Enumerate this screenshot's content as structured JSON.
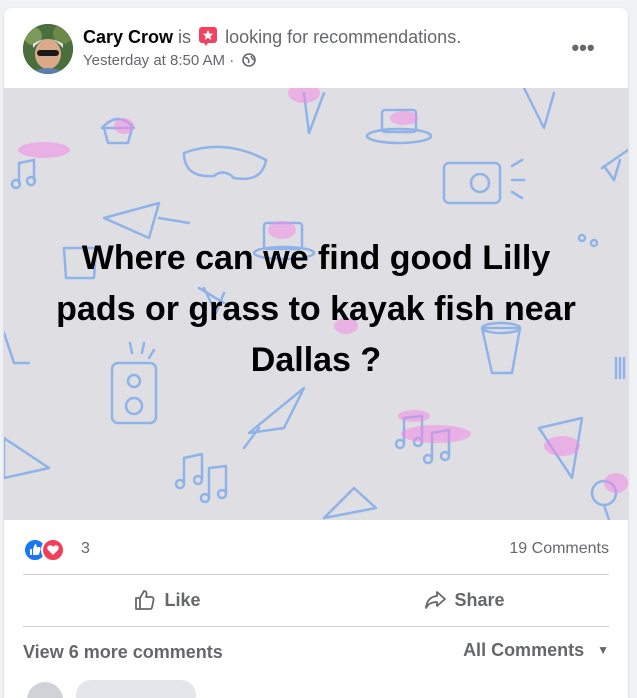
{
  "post": {
    "author": "Cary Crow",
    "is_text": "is",
    "activity": "looking for recommendations.",
    "timestamp": "Yesterday at 8:50 AM ·",
    "text": "Where can we find good Lilly pads or grass to kayak fish near Dallas ?"
  },
  "icons": {
    "activity": "recommendation-star-icon",
    "privacy": "globe-icon",
    "more": "more-horizontal-icon",
    "reactions": [
      "like-reaction-icon",
      "love-reaction-icon"
    ],
    "like": "thumbs-up-icon",
    "share": "share-arrow-icon",
    "sort": "caret-down-icon"
  },
  "more_menu": "•••",
  "stats": {
    "reaction_count": "3",
    "comments": "19 Comments"
  },
  "actions": {
    "like": "Like",
    "share": "Share"
  },
  "comments_bar": {
    "view_more": "View 6 more comments",
    "sort": "All Comments"
  },
  "colors": {
    "background": "#dfdfe3",
    "secondary_text": "#65676b",
    "like_blue": "#1877f2",
    "love_red": "#f33e58",
    "deco_blue": "#8fb3e8",
    "deco_pink": "#f08be5"
  }
}
